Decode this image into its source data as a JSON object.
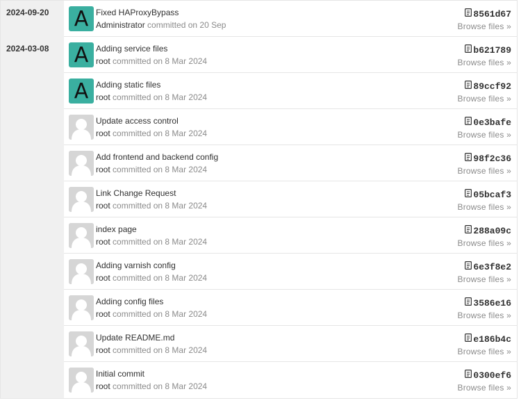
{
  "browse_label": "Browse files »",
  "committed_on_word": "committed on",
  "days": [
    {
      "date": "2024-09-20",
      "commits": [
        {
          "title": "Fixed HAProxyBypass",
          "author": "Administrator",
          "when": "20 Sep",
          "sha": "8561d67",
          "avatar": "letter",
          "avatar_letter": "A"
        }
      ]
    },
    {
      "date": "2024-03-08",
      "commits": [
        {
          "title": "Adding service files",
          "author": "root",
          "when": "8 Mar 2024",
          "sha": "b621789",
          "avatar": "letter",
          "avatar_letter": "A"
        },
        {
          "title": "Adding static files",
          "author": "root",
          "when": "8 Mar 2024",
          "sha": "89ccf92",
          "avatar": "letter",
          "avatar_letter": "A"
        },
        {
          "title": "Update access control",
          "author": "root",
          "when": "8 Mar 2024",
          "sha": "0e3bafe",
          "avatar": "default",
          "avatar_letter": ""
        },
        {
          "title": "Add frontend and backend config",
          "author": "root",
          "when": "8 Mar 2024",
          "sha": "98f2c36",
          "avatar": "default",
          "avatar_letter": ""
        },
        {
          "title": "Link Change Request",
          "author": "root",
          "when": "8 Mar 2024",
          "sha": "05bcaf3",
          "avatar": "default",
          "avatar_letter": ""
        },
        {
          "title": "index page",
          "author": "root",
          "when": "8 Mar 2024",
          "sha": "288a09c",
          "avatar": "default",
          "avatar_letter": ""
        },
        {
          "title": "Adding varnish config",
          "author": "root",
          "when": "8 Mar 2024",
          "sha": "6e3f8e2",
          "avatar": "default",
          "avatar_letter": ""
        },
        {
          "title": "Adding config files",
          "author": "root",
          "when": "8 Mar 2024",
          "sha": "3586e16",
          "avatar": "default",
          "avatar_letter": ""
        },
        {
          "title": "Update README.md",
          "author": "root",
          "when": "8 Mar 2024",
          "sha": "e186b4c",
          "avatar": "default",
          "avatar_letter": ""
        },
        {
          "title": "Initial commit",
          "author": "root",
          "when": "8 Mar 2024",
          "sha": "0300ef6",
          "avatar": "default",
          "avatar_letter": ""
        }
      ]
    }
  ]
}
